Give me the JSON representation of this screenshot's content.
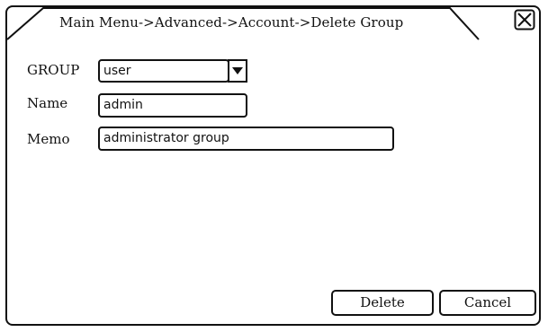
{
  "dialog": {
    "breadcrumb_title": "Main Menu->Advanced->Account->Delete Group",
    "close_icon": "close-x-box-icon"
  },
  "form": {
    "group_label": "GROUP",
    "group_value": "user",
    "dropdown_icon": "triangle-down-icon",
    "name_label": "Name",
    "name_value": "admin",
    "memo_label": "Memo",
    "memo_value": "administrator group"
  },
  "buttons": {
    "delete_label": "Delete",
    "cancel_label": "Cancel"
  }
}
